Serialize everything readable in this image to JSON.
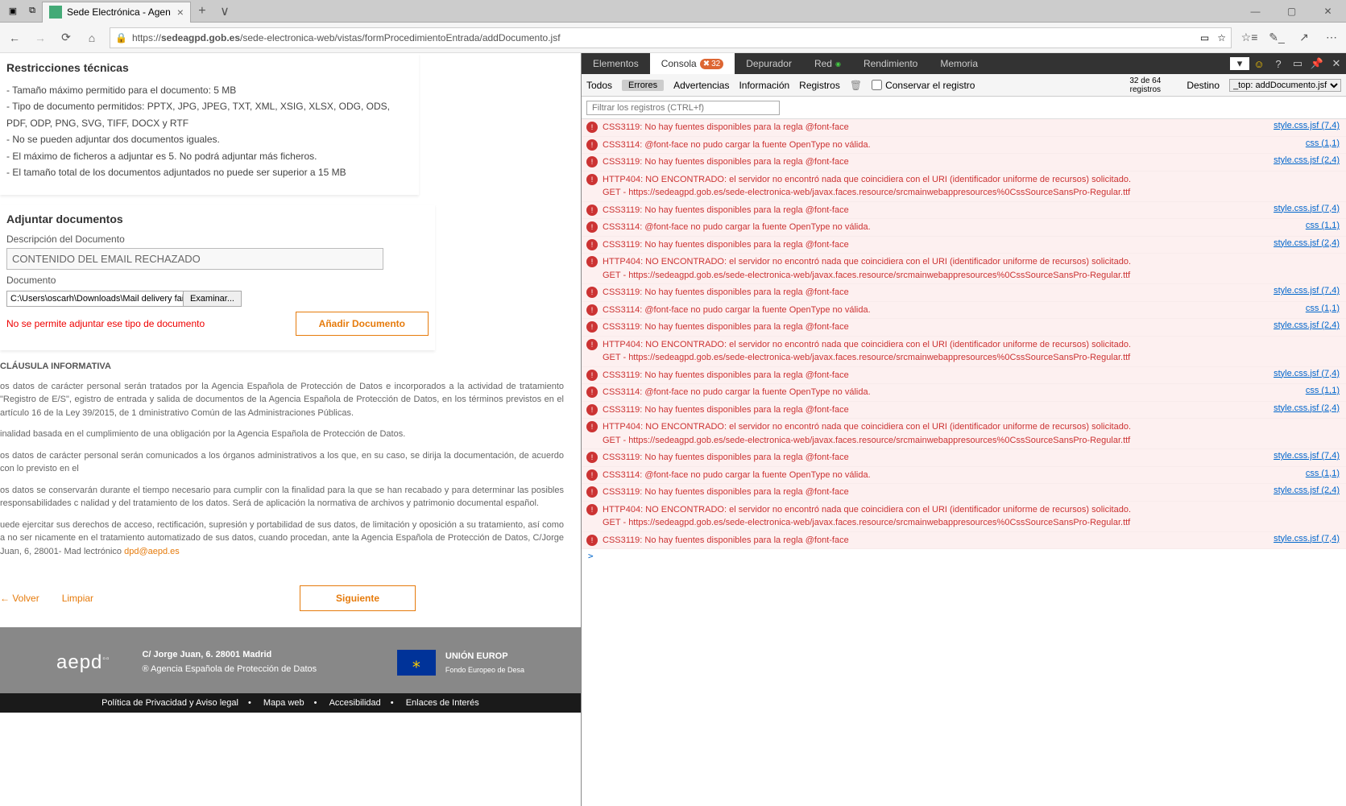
{
  "browser": {
    "tab_title": "Sede Electrónica - Agen",
    "url_host": "https://",
    "url_bold": "sedeagpd.gob.es",
    "url_path": "/sede-electronica-web/vistas/formProcedimientoEntrada/addDocumento.jsf",
    "minimize": "—",
    "mult": "∨"
  },
  "restrictions": {
    "title": "Restricciones técnicas",
    "items": [
      "- Tamaño máximo permitido para el documento: 5 MB",
      "- Tipo de documento permitidos: PPTX, JPG, JPEG, TXT, XML, XSIG, XLSX, ODG, ODS, PDF, ODP, PNG, SVG, TIFF, DOCX y RTF",
      "- No se pueden adjuntar dos documentos iguales.",
      "- El máximo de ficheros a adjuntar es 5. No podrá adjuntar más ficheros.",
      "- El tamaño total de los documentos adjuntados no puede ser superior a 15 MB"
    ]
  },
  "attach": {
    "title": "Adjuntar documentos",
    "desc_label": "Descripción del Documento",
    "desc_value": "CONTENIDO DEL EMAIL RECHAZADO",
    "doc_label": "Documento",
    "file_path": "C:\\Users\\oscarh\\Downloads\\Mail delivery failed_ returnin",
    "browse": "Examinar...",
    "error": "No se permite adjuntar ese tipo de documento",
    "add_btn": "Añadir Documento"
  },
  "legal": {
    "title": "CLÁUSULA INFORMATIVA",
    "p1": "os datos de carácter personal serán tratados por la Agencia Española de Protección de Datos e incorporados a la actividad de tratamiento \"Registro de E/S\", egistro de entrada y salida de documentos de la Agencia Española de Protección de Datos, en los términos previstos en el artículo 16 de la Ley 39/2015, de 1 dministrativo Común de las Administraciones Públicas.",
    "p2": "inalidad basada en el cumplimiento de una obligación por la Agencia Española de Protección de Datos.",
    "p3": "os datos de carácter personal serán comunicados a los órganos administrativos a los que, en su caso, se dirija la documentación, de acuerdo con lo previsto en el",
    "p4": "os datos se conservarán durante el tiempo necesario para cumplir con la finalidad para la que se han recabado y para determinar las posibles responsabilidades c nalidad y del tratamiento de los datos. Será de aplicación la normativa de archivos y patrimonio documental español.",
    "p5_a": "uede ejercitar sus derechos de acceso, rectificación, supresión y portabilidad de sus datos, de limitación y oposición a su tratamiento, así como a no ser nicamente en el tratamiento automatizado de sus datos, cuando procedan, ante la Agencia Española de Protección de Datos, C/Jorge Juan, 6, 28001- Mad lectrónico ",
    "p5_link": "dpd@aepd.es"
  },
  "actions": {
    "back": "←  Volver",
    "clear": "Limpiar",
    "next": "Siguiente"
  },
  "footer": {
    "addr": "C/ Jorge Juan, 6. 28001 Madrid",
    "org": "® Agencia Española de Protección de Datos",
    "eu": "UNIÓN EUROP",
    "eu2": "Fondo Europeo de Desa",
    "links": [
      "Política de Privacidad y Aviso legal",
      "Mapa web",
      "Accesibilidad",
      "Enlaces de Interés"
    ]
  },
  "devtools": {
    "tabs": [
      "Elementos",
      "Consola",
      "Depurador",
      "Red",
      "Rendimiento",
      "Memoria"
    ],
    "console_badge": "32",
    "filters": {
      "todos": "Todos",
      "errores": "Errores",
      "adv": "Advertencias",
      "info": "Información",
      "reg": "Registros"
    },
    "preserve": "Conservar el registro",
    "count": "32 de 64\nregistros",
    "dest_label": "Destino",
    "dest_value": "_top: addDocumento.jsf",
    "filter_placeholder": "Filtrar los registros (CTRL+f)",
    "logs": [
      {
        "msg": "CSS3119: No hay fuentes disponibles para la regla @font-face",
        "src": "style.css.jsf (7,4)"
      },
      {
        "msg": "CSS3114: @font-face no pudo cargar la fuente OpenType no válida.",
        "src": "css (1,1)"
      },
      {
        "msg": "CSS3119: No hay fuentes disponibles para la regla @font-face",
        "src": "style.css.jsf (2,4)"
      },
      {
        "msg": "HTTP404: NO ENCONTRADO: el servidor no encontró nada que coincidiera con el URI (identificador uniforme de recursos) solicitado.\nGET - https://sedeagpd.gob.es/sede-electronica-web/javax.faces.resource/srcmainwebappresources%0CssSourceSansPro-Regular.ttf",
        "src": ""
      },
      {
        "msg": "CSS3119: No hay fuentes disponibles para la regla @font-face",
        "src": "style.css.jsf (7,4)"
      },
      {
        "msg": "CSS3114: @font-face no pudo cargar la fuente OpenType no válida.",
        "src": "css (1,1)"
      },
      {
        "msg": "CSS3119: No hay fuentes disponibles para la regla @font-face",
        "src": "style.css.jsf (2,4)"
      },
      {
        "msg": "HTTP404: NO ENCONTRADO: el servidor no encontró nada que coincidiera con el URI (identificador uniforme de recursos) solicitado.\nGET - https://sedeagpd.gob.es/sede-electronica-web/javax.faces.resource/srcmainwebappresources%0CssSourceSansPro-Regular.ttf",
        "src": ""
      },
      {
        "msg": "CSS3119: No hay fuentes disponibles para la regla @font-face",
        "src": "style.css.jsf (7,4)"
      },
      {
        "msg": "CSS3114: @font-face no pudo cargar la fuente OpenType no válida.",
        "src": "css (1,1)"
      },
      {
        "msg": "CSS3119: No hay fuentes disponibles para la regla @font-face",
        "src": "style.css.jsf (2,4)"
      },
      {
        "msg": "HTTP404: NO ENCONTRADO: el servidor no encontró nada que coincidiera con el URI (identificador uniforme de recursos) solicitado.\nGET - https://sedeagpd.gob.es/sede-electronica-web/javax.faces.resource/srcmainwebappresources%0CssSourceSansPro-Regular.ttf",
        "src": ""
      },
      {
        "msg": "CSS3119: No hay fuentes disponibles para la regla @font-face",
        "src": "style.css.jsf (7,4)"
      },
      {
        "msg": "CSS3114: @font-face no pudo cargar la fuente OpenType no válida.",
        "src": "css (1,1)"
      },
      {
        "msg": "CSS3119: No hay fuentes disponibles para la regla @font-face",
        "src": "style.css.jsf (2,4)"
      },
      {
        "msg": "HTTP404: NO ENCONTRADO: el servidor no encontró nada que coincidiera con el URI (identificador uniforme de recursos) solicitado.\nGET - https://sedeagpd.gob.es/sede-electronica-web/javax.faces.resource/srcmainwebappresources%0CssSourceSansPro-Regular.ttf",
        "src": ""
      },
      {
        "msg": "CSS3119: No hay fuentes disponibles para la regla @font-face",
        "src": "style.css.jsf (7,4)"
      },
      {
        "msg": "CSS3114: @font-face no pudo cargar la fuente OpenType no válida.",
        "src": "css (1,1)"
      },
      {
        "msg": "CSS3119: No hay fuentes disponibles para la regla @font-face",
        "src": "style.css.jsf (2,4)"
      },
      {
        "msg": "HTTP404: NO ENCONTRADO: el servidor no encontró nada que coincidiera con el URI (identificador uniforme de recursos) solicitado.\nGET - https://sedeagpd.gob.es/sede-electronica-web/javax.faces.resource/srcmainwebappresources%0CssSourceSansPro-Regular.ttf",
        "src": ""
      },
      {
        "msg": "CSS3119: No hay fuentes disponibles para la regla @font-face",
        "src": "style.css.jsf (7,4)"
      }
    ]
  }
}
